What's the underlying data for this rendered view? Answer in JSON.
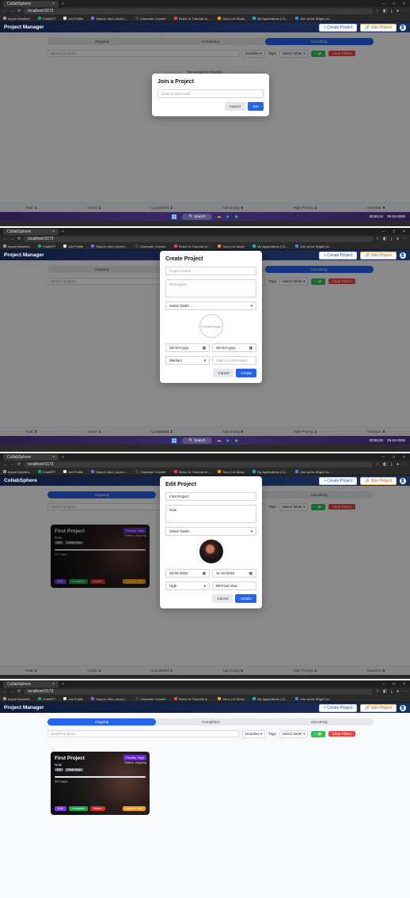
{
  "browser": {
    "tab_title": "CollabSphere",
    "url": "localhost:5173",
    "bookmarks": [
      "Import favorites",
      "ChatGPT",
      "Job Profile",
      "Search Jobs | Accen...",
      "Character Counter",
      "React Js Tutorials fo...",
      "Suno | AI Music",
      "My Applications | Ci...",
      "Join us for Bright Ca..."
    ]
  },
  "screens": [
    {
      "app_title": "Project Manager",
      "active_tab": 2,
      "modal": "join",
      "show_no_projects": true,
      "show_card": false,
      "footer_total": "2",
      "footer_active": "1",
      "footer_completed": "1",
      "footer_upcoming": "0",
      "footer_high": "1",
      "footer_overdue": "0",
      "taskbar": true,
      "time": "20:55:12",
      "date": "29-10-2025"
    },
    {
      "app_title": "Project Manager",
      "active_tab": 2,
      "modal": "create",
      "show_no_projects": false,
      "show_card": false,
      "footer_total": "2",
      "footer_active": "1",
      "footer_completed": "1",
      "footer_upcoming": "0",
      "footer_high": "1",
      "footer_overdue": "0",
      "taskbar": true,
      "time": "20:55:25",
      "date": "29-10-2025"
    },
    {
      "app_title": "CollabSphere",
      "active_tab": 0,
      "modal": "edit",
      "show_no_projects": false,
      "show_card": true,
      "footer_total": "2",
      "footer_active": "1",
      "footer_completed": "1",
      "footer_upcoming": "0",
      "footer_high": "1",
      "footer_overdue": "0",
      "taskbar": false
    },
    {
      "app_title": "Project Manager",
      "active_tab": 0,
      "modal": null,
      "show_no_projects": false,
      "show_card": true,
      "footer_total": "2",
      "footer_active": "1",
      "footer_completed": "1",
      "footer_upcoming": "0",
      "footer_high": "1",
      "footer_overdue": "0",
      "taskbar": false
    }
  ],
  "header": {
    "create_label": "+ Create Project",
    "join_label": "🔗 Join Project",
    "avatar": "👤"
  },
  "tabs": [
    "Ongoing",
    "Completed",
    "Upcoming"
  ],
  "filters": {
    "search_placeholder": "Search projects...",
    "deadline": "Deadline",
    "tags": "Tags",
    "folder": "Select folder",
    "add": "+ 📁",
    "clear": "Clear Filters"
  },
  "empty_text": "No projects found.",
  "footer_labels": {
    "total": "Total:",
    "active": "Active:",
    "completed": "Completed:",
    "upcoming": "Upcoming:",
    "high": "High Priority:",
    "overdue": "Overdue:"
  },
  "join_modal": {
    "title": "Join a Project",
    "placeholder": "Enter project code",
    "cancel": "Cancel",
    "join": "Join"
  },
  "create_modal": {
    "title": "Create Project",
    "name_placeholder": "Project Name",
    "desc_placeholder": "Description",
    "folder": "Select folder...",
    "image": "Choose Image",
    "start_date": "dd-mm-yyyy",
    "end_date": "dd-mm-yyyy",
    "priority": "Medium",
    "tags_placeholder": "Tags (comma separ...",
    "cancel": "Cancel",
    "create": "Create"
  },
  "edit_modal": {
    "title": "Edit Project",
    "name": "First Project",
    "desc": "Now",
    "folder": "Select folder...",
    "start_date": "28-09-2025",
    "end_date": "31-10-2025",
    "priority": "High",
    "tags": "RP,Final Year",
    "cancel": "Cancel",
    "update": "Update"
  },
  "card": {
    "title": "First Project",
    "priority": "Priority: High",
    "status": "Status: ongoing",
    "desc": "Now",
    "chips": [
      "RP",
      "Final Year"
    ],
    "days_left": "307 tasks",
    "edit": "Edit",
    "complete": "Complete",
    "delete": "Delete",
    "dates": "Dates & Info"
  },
  "colors": {
    "accent": "#2563eb",
    "header": "#1b2d5a",
    "green": "#22c55e",
    "red": "#ef4444"
  }
}
